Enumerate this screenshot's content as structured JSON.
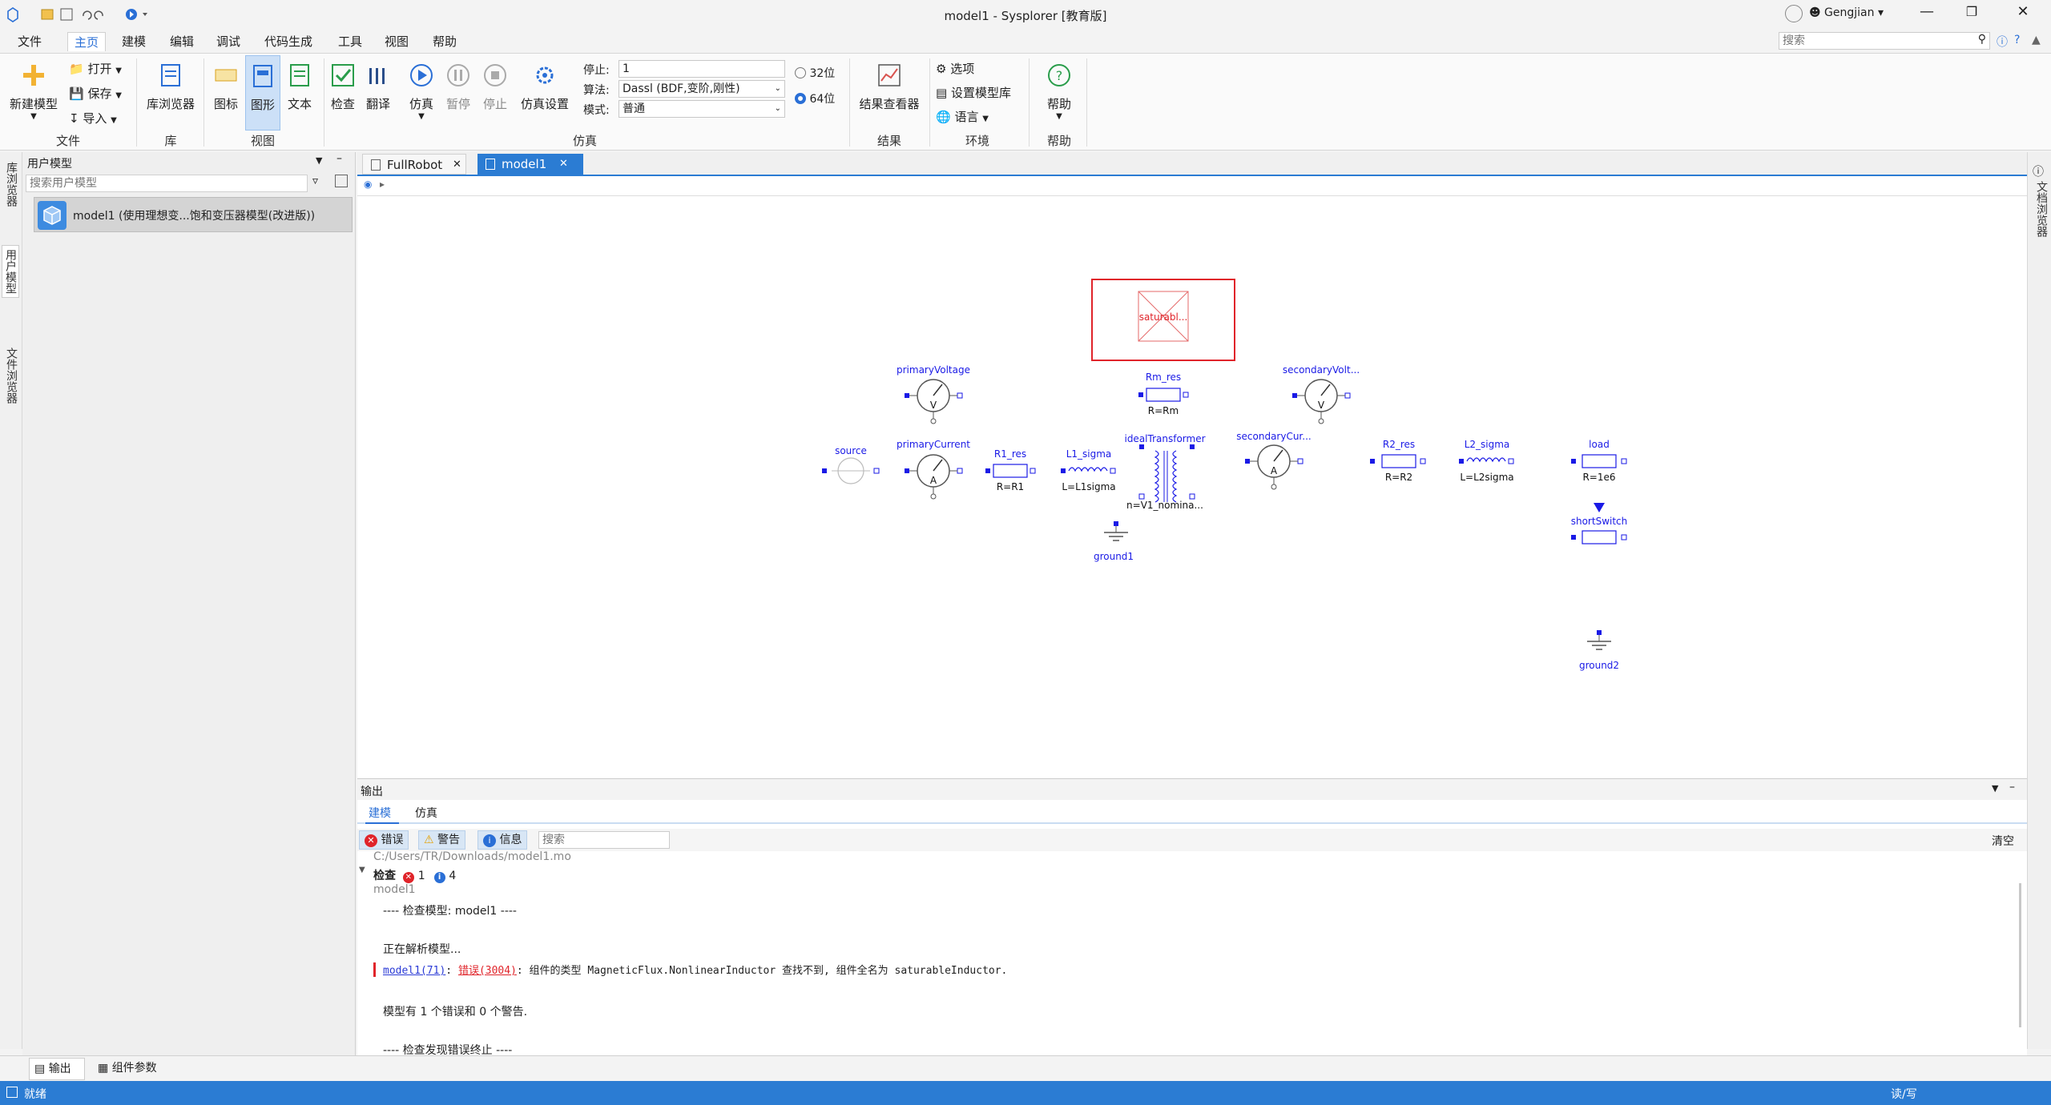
{
  "window": {
    "title": "model1 - Sysplorer [教育版]",
    "user": "Gengjian",
    "search_placeholder": "搜索"
  },
  "menu": [
    "文件",
    "主页",
    "建模",
    "编辑",
    "调试",
    "代码生成",
    "工具",
    "视图",
    "帮助"
  ],
  "ribbon": {
    "file": {
      "new_model": "新建模型",
      "open": "打开",
      "save": "保存",
      "import": "导入",
      "group": "文件"
    },
    "library": {
      "browser": "库浏览器",
      "group": "库"
    },
    "view": {
      "icon": "图标",
      "graphic": "图形",
      "text": "文本",
      "group": "视图"
    },
    "sim": {
      "check": "检查",
      "translate": "翻译",
      "simulate": "仿真",
      "pause": "暂停",
      "stop": "停止",
      "settings": "仿真设置",
      "group": "仿真",
      "stop_label": "停止:",
      "stop_value": "1",
      "algo_label": "算法:",
      "algo_value": "Dassl (BDF,变阶,刚性)",
      "mode_label": "模式:",
      "mode_value": "普通",
      "bit32": "32位",
      "bit64": "64位"
    },
    "result": {
      "viewer": "结果查看器",
      "group": "结果"
    },
    "env": {
      "options": "选项",
      "set_lib": "设置模型库",
      "language": "语言",
      "group": "环境"
    },
    "help": {
      "help": "帮助",
      "group": "帮助"
    }
  },
  "left_strip": [
    "库浏览器",
    "用户模型",
    "文件浏览器"
  ],
  "left_panel": {
    "title": "用户模型",
    "search_placeholder": "搜索用户模型",
    "item": "model1 (使用理想变...饱和变压器模型(改进版))"
  },
  "right_strip": [
    "文档浏览器"
  ],
  "doc_tabs": [
    {
      "label": "FullRobot",
      "active": false
    },
    {
      "label": "model1",
      "active": true
    }
  ],
  "diagram": {
    "saturable": "saturabl...",
    "primaryVoltage": "primaryVoltage",
    "Rm_res": "Rm_res",
    "Rm_val": "R=Rm",
    "secondaryVoltage": "secondaryVolt...",
    "source": "source",
    "primaryCurrent": "primaryCurrent",
    "R1_res": "R1_res",
    "R1_val": "R=R1",
    "L1_sigma": "L1_sigma",
    "L1_val": "L=L1sigma",
    "idealTransformer": "idealTransformer",
    "idealT_val": "n=V1_nomina...",
    "secondaryCurrent": "secondaryCur...",
    "R2_res": "R2_res",
    "R2_val": "R=R2",
    "L2_sigma": "L2_sigma",
    "L2_val": "L=L2sigma",
    "load": "load",
    "load_val": "R=1e6",
    "shortSwitch": "shortSwitch",
    "ground1": "ground1",
    "ground2": "ground2",
    "V": "V",
    "A": "A"
  },
  "output": {
    "title": "输出",
    "tabs": [
      "建模",
      "仿真"
    ],
    "filters": {
      "error": "错误",
      "warning": "警告",
      "info": "信息",
      "search_placeholder": "搜索"
    },
    "clear": "清空",
    "path": "C:/Users/TR/Downloads/model1.mo",
    "check_label": "检查",
    "err_count": "1",
    "info_count": "4",
    "model": "model1",
    "line1": "---- 检查模型: model1 ----",
    "line2": "正在解析模型...",
    "err_link": "model1(71)",
    "err_sep": ": ",
    "err_code": "错误(3004)",
    "err_msg": ": 组件的类型 MagneticFlux.NonlinearInductor 查找不到, 组件全名为 saturableInductor.",
    "line3": "模型有 1 个错误和 0 个警告.",
    "line4": "---- 检查发现错误终止 ----"
  },
  "bottom_tabs": [
    "输出",
    "组件参数"
  ],
  "status": {
    "left": "就绪",
    "right": "读/写"
  },
  "colors": {
    "accent": "#2b7cd3",
    "diagram_blue": "#1a1ae6",
    "error_red": "#e0242a"
  }
}
